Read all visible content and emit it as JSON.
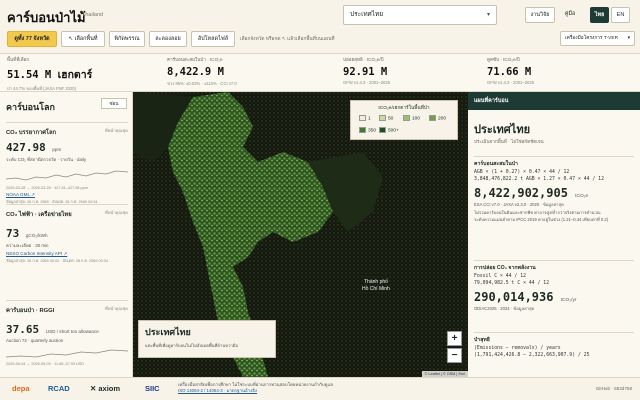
{
  "header": {
    "brand": "คาร์บอนป่าไม้",
    "brand_sub": "Thailand",
    "view_all": "ดูทั้ง 77 จังหวัด",
    "select_area": "เลือกพื้นที่",
    "draw": "พิกัดพรรณ",
    "clear": "ละลองลอย",
    "upload": "อัปโหลดไฟล์",
    "hint": "เลือกจังหวัด หรือกด ↖ แล้วเลือกพื้นที่บนแผนที่",
    "region_value": "ประเทศไทย",
    "method_btn": "งานวิจัย",
    "manual_btn": "คู่มือ",
    "lang_th": "ไทย",
    "lang_en": "EN",
    "tool_select": "เครื่องมือโครงการ T-VER"
  },
  "stats": [
    {
      "label": "พื้นที่ที่เลือก",
      "value": "51.54 M เฮกตาร์",
      "note": "ป่า 44.7% ของพื้นที่ (JAXA FNF 2020)"
    },
    {
      "label": "คาร์บอนสะสมในป่า · tCO₂e",
      "value": "8,422.9 M",
      "note": "ช่วง 95%: ±0.03% · ±110% · CCI v7.0"
    },
    {
      "label": "ปล่อยสุทธิ · tCO₂e/ปี",
      "value": "92.91 M",
      "note": "GFW v1.4.3 · 2001–2025"
    },
    {
      "label": "ดูดซับ · tCO₂e/ปี",
      "value": "71.66 M",
      "note": "GFW v1.4.3 · 2001–2025"
    }
  ],
  "left": {
    "title": "คาร์บอนโลก",
    "close": "ซ่อน",
    "cards": [
      {
        "title": "CO₂ บรรยากาศโลก",
        "side": "ที่หน้าคุณชุด",
        "value": "427.98",
        "unit": "ppm",
        "desc": "ระดับ CO₂ ที่สถานีตรวจวัด · รายวัน · daily",
        "tiny": "2026-03-28 → 2026-03-26 · 427.81–427.98 ppm",
        "link": "NOAA GML ↗",
        "tiny2": "ข้อมูลล่าสุด: 26 ก.ค. 2569 · อัปเดต: 28 ก.ค. 2569 00:34"
      },
      {
        "title": "CO₂ ไฟฟ้า · เครือข่ายไทย",
        "side": "ที่หน้าคุณชุด",
        "value": "73",
        "unit": "gCO₂/kWh",
        "desc": "ความละเอียด · 30 min",
        "tiny": "",
        "link": "NESO Carbon Intensity API ↗",
        "tiny2": "ข้อมูลล่าสุด: 28 ก.ค. 2569 00:00 · อัปเดต: 28 ก.ค. 2569 00:34"
      },
      {
        "title": "คาร์บอนป่า · RGGI",
        "side": "ที่หน้าคุณชุด",
        "value": "37.65",
        "unit": "USD / short ton allowance",
        "desc": "Auction 73 · quarterly auction",
        "tiny": "2026-06-04 → 2026-09-09 · 11.65–37.93 USD",
        "link": "",
        "tiny2": ""
      }
    ]
  },
  "map": {
    "legend_title": "tCO₂e/เฮกตาร์ในพื้นที่ป่า",
    "legend": [
      {
        "label": "1",
        "color": "#f1eed8"
      },
      {
        "label": "50",
        "color": "#c6dc9c"
      },
      {
        "label": "100",
        "color": "#99c26c"
      },
      {
        "label": "200",
        "color": "#6da344"
      },
      {
        "label": "350",
        "color": "#3f7a2c"
      },
      {
        "label": "500+",
        "color": "#1f4e1d"
      }
    ],
    "card_title": "ประเทศไทย",
    "card_desc": "แตะพื้นที่เพื่อดูคาร์บอนใน/ไม่อัปเดตพื้นที่ด้านขวามือ",
    "zoom_in": "+",
    "zoom_out": "−",
    "attribution": "© Leaflet | © OSM | Esri",
    "labels": [
      "Thành phố",
      "Hồ Chí Minh",
      "Phnom Penh"
    ]
  },
  "right": {
    "head": "แผนที่คาร์บอน",
    "title": "ประเทศไทย",
    "subtitle": "ประเมินจากพื้นที่ · ไม่ใช่สกัดชัดเจน",
    "sec1_title": "คาร์บอนสะสมในป่า",
    "sec1_side": "เปิด/ปิด",
    "sec1_f1": "AGB × (1 + 0.27) × 0.47 × 44 / 12",
    "sec1_f2": "3,848,476,822.2 t AGB × 1.27 × 0.47 × 44 / 12",
    "sec1_value": "8,422,902,905",
    "sec1_unit": "tCO₂e",
    "sec1_note": "ESA CCI v7.0 · JAXA v2.3.0 · 2020 · ข้อมูลล่าสุด",
    "sec1_note2": "ไม่รวมคาร์บอนในดินและซากพืช ค่าอาจสูง/ต่ำกว่าจริงตามการคำนวณ",
    "sec1_note3": "ระดับความแม่นยำตาม IPCC 2019 ค่าอยู่ในช่วง (1.21–0.44 เทียบค่าที่ 0.2)",
    "sec2_title": "การปล่อย CO₂ จากพลังงาน",
    "sec2_f1": "Fossil C × 44 / 12",
    "sec2_f2": "79,094,982.5 t C × 44 / 12",
    "sec2_value": "290,014,936",
    "sec2_unit": "tCO₂/yr",
    "sec2_note": "ODIAC2025 · 2024 · ข้อมูลล่าสุด",
    "sec3_title": "ป่าสุทธิ",
    "sec3_f1": "(Emissions − removals) / years",
    "sec3_f2": "(1,791,424,426.8 − 2,322,663,907.9) / 25"
  },
  "footer": {
    "logos": [
      "depa",
      "RCAD",
      "axiom",
      "SIIC"
    ],
    "text1": "เครื่องมือสาธิตเพื่อการศึกษา ไม่ใช่ระบบที่ผ่านการทวนสอบโดยหน่วยงานกำกับดูแล",
    "text2": "ISO 14064-2 / 14064-3 · มาตรฐานอ้างอิง",
    "right": "GitHub · 583d758"
  }
}
